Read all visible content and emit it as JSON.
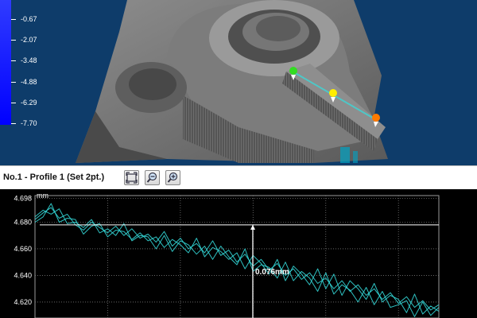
{
  "view3d": {
    "scale_labels": [
      "-0.67",
      "-2.07",
      "-3.48",
      "-4.88",
      "-6.29",
      "-7.70"
    ],
    "colors": {
      "background": "#0e3c6a",
      "scale_bar": "#0000ff",
      "part": "#6a6a6a"
    },
    "markers": [
      {
        "name": "point-1",
        "color": "#33dd22"
      },
      {
        "name": "point-2",
        "color": "#ffee00"
      },
      {
        "name": "point-3",
        "color": "#ff7a00"
      }
    ]
  },
  "profile": {
    "title": "No.1 - Profile 1 (Set 2pt.)",
    "toolbar": [
      {
        "name": "fit-view-button",
        "icon": "fit-view-icon"
      },
      {
        "name": "zoom-out-button",
        "icon": "zoom-out-icon"
      },
      {
        "name": "zoom-in-button",
        "icon": "zoom-in-icon"
      }
    ]
  },
  "chart_data": {
    "type": "line",
    "ylabel": "mm",
    "yticks": [
      "4.698",
      "4.680",
      "4.660",
      "4.640",
      "4.620"
    ],
    "ylim": [
      4.608,
      4.7
    ],
    "grid": true,
    "annotation": {
      "label": "0.076mm",
      "reference_y": 4.678
    },
    "series_color": "#33d6d6",
    "series": [
      {
        "x": [
          0,
          0.02,
          0.04,
          0.06,
          0.08,
          0.1,
          0.12,
          0.14,
          0.16,
          0.18,
          0.2,
          0.22,
          0.24,
          0.26,
          0.28,
          0.3,
          0.32,
          0.34,
          0.36,
          0.38,
          0.4,
          0.42,
          0.44,
          0.46,
          0.48,
          0.5,
          0.52,
          0.54,
          0.56,
          0.58,
          0.6,
          0.62,
          0.64,
          0.66,
          0.68,
          0.7,
          0.72,
          0.74,
          0.76,
          0.78,
          0.8,
          0.82,
          0.84,
          0.86,
          0.88,
          0.9,
          0.92,
          0.94,
          0.96,
          0.98,
          1.0
        ],
        "values": [
          4.682,
          4.687,
          4.691,
          4.683,
          4.686,
          4.678,
          4.674,
          4.68,
          4.676,
          4.672,
          4.677,
          4.67,
          4.675,
          4.668,
          4.671,
          4.665,
          4.673,
          4.662,
          4.668,
          4.66,
          4.664,
          4.657,
          4.666,
          4.655,
          4.659,
          4.65,
          4.656,
          4.647,
          4.652,
          4.644,
          4.649,
          4.64,
          4.645,
          4.637,
          4.642,
          4.634,
          4.638,
          4.63,
          4.636,
          4.628,
          4.633,
          4.625,
          4.63,
          4.622,
          4.627,
          4.619,
          4.624,
          4.616,
          4.621,
          4.614,
          4.618
        ]
      },
      {
        "x": [
          0,
          0.02,
          0.04,
          0.06,
          0.08,
          0.1,
          0.12,
          0.14,
          0.16,
          0.18,
          0.2,
          0.22,
          0.24,
          0.26,
          0.28,
          0.3,
          0.32,
          0.34,
          0.36,
          0.38,
          0.4,
          0.42,
          0.44,
          0.46,
          0.48,
          0.5,
          0.52,
          0.54,
          0.56,
          0.58,
          0.6,
          0.62,
          0.64,
          0.66,
          0.68,
          0.7,
          0.72,
          0.74,
          0.76,
          0.78,
          0.8,
          0.82,
          0.84,
          0.86,
          0.88,
          0.9,
          0.92,
          0.94,
          0.96,
          0.98,
          1.0
        ],
        "values": [
          4.68,
          4.684,
          4.694,
          4.68,
          4.683,
          4.682,
          4.671,
          4.677,
          4.679,
          4.669,
          4.674,
          4.673,
          4.667,
          4.672,
          4.666,
          4.669,
          4.661,
          4.667,
          4.663,
          4.657,
          4.668,
          4.654,
          4.661,
          4.658,
          4.652,
          4.657,
          4.645,
          4.655,
          4.649,
          4.641,
          4.652,
          4.636,
          4.647,
          4.641,
          4.633,
          4.645,
          4.63,
          4.641,
          4.625,
          4.636,
          4.63,
          4.622,
          4.634,
          4.62,
          4.625,
          4.622,
          4.612,
          4.626,
          4.611,
          4.617,
          4.613
        ]
      },
      {
        "x": [
          0,
          0.02,
          0.04,
          0.06,
          0.08,
          0.1,
          0.12,
          0.14,
          0.16,
          0.18,
          0.2,
          0.22,
          0.24,
          0.26,
          0.28,
          0.3,
          0.32,
          0.34,
          0.36,
          0.38,
          0.4,
          0.42,
          0.44,
          0.46,
          0.48,
          0.5,
          0.52,
          0.54,
          0.56,
          0.58,
          0.6,
          0.62,
          0.64,
          0.66,
          0.68,
          0.7,
          0.72,
          0.74,
          0.76,
          0.78,
          0.8,
          0.82,
          0.84,
          0.86,
          0.88,
          0.9,
          0.92,
          0.94,
          0.96,
          0.98,
          1.0
        ],
        "values": [
          4.684,
          4.689,
          4.686,
          4.69,
          4.679,
          4.68,
          4.676,
          4.682,
          4.672,
          4.675,
          4.67,
          4.679,
          4.666,
          4.67,
          4.669,
          4.66,
          4.67,
          4.658,
          4.666,
          4.663,
          4.656,
          4.662,
          4.652,
          4.662,
          4.654,
          4.648,
          4.66,
          4.643,
          4.648,
          4.646,
          4.638,
          4.65,
          4.636,
          4.643,
          4.638,
          4.628,
          4.642,
          4.626,
          4.633,
          4.629,
          4.62,
          4.631,
          4.618,
          4.628,
          4.616,
          4.618,
          4.621,
          4.609,
          4.62,
          4.61,
          4.616
        ]
      }
    ]
  }
}
